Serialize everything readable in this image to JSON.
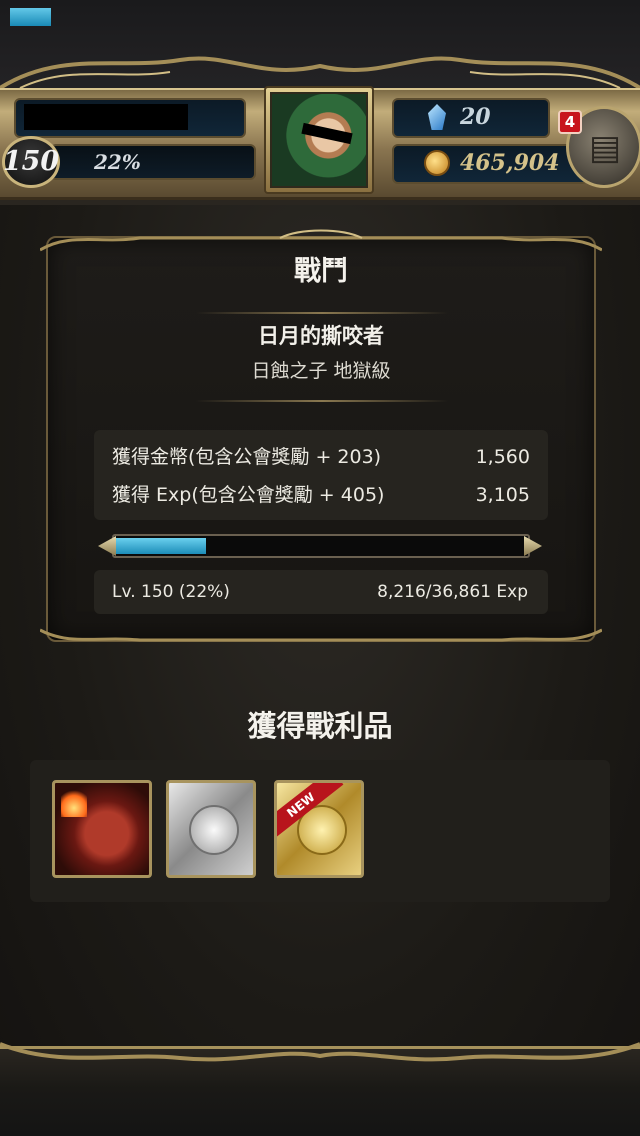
{
  "header": {
    "level": "150",
    "exp_percent_label": "22%",
    "exp_fraction": 0.22,
    "gems": "20",
    "coins": "465,904",
    "notification_count": "4",
    "menu_icon": "menu-book-icon"
  },
  "battle": {
    "title": "戰鬥",
    "stage_name": "日月的撕咬者",
    "stage_subtitle": "日蝕之子 地獄級",
    "rewards": [
      {
        "label": "獲得金幣(包含公會獎勵 + 203)",
        "value": "1,560"
      },
      {
        "label": "獲得 Exp(包含公會獎勵 + 405)",
        "value": "3,105"
      }
    ],
    "exp_bar_fraction": 0.22,
    "level_line": "Lv. 150 (22%)",
    "exp_line": "8,216/36,861 Exp"
  },
  "loot": {
    "title": "獲得戰利品",
    "items": [
      {
        "name": "red-wolf-card",
        "new": false
      },
      {
        "name": "silver-medal-card",
        "new": false
      },
      {
        "name": "gold-medal-card",
        "new": true,
        "badge": "NEW"
      }
    ]
  },
  "colors": {
    "exp_fill": "#1d8db8",
    "frame_gold": "#c2ad7a",
    "badge_red": "#c8141c"
  }
}
